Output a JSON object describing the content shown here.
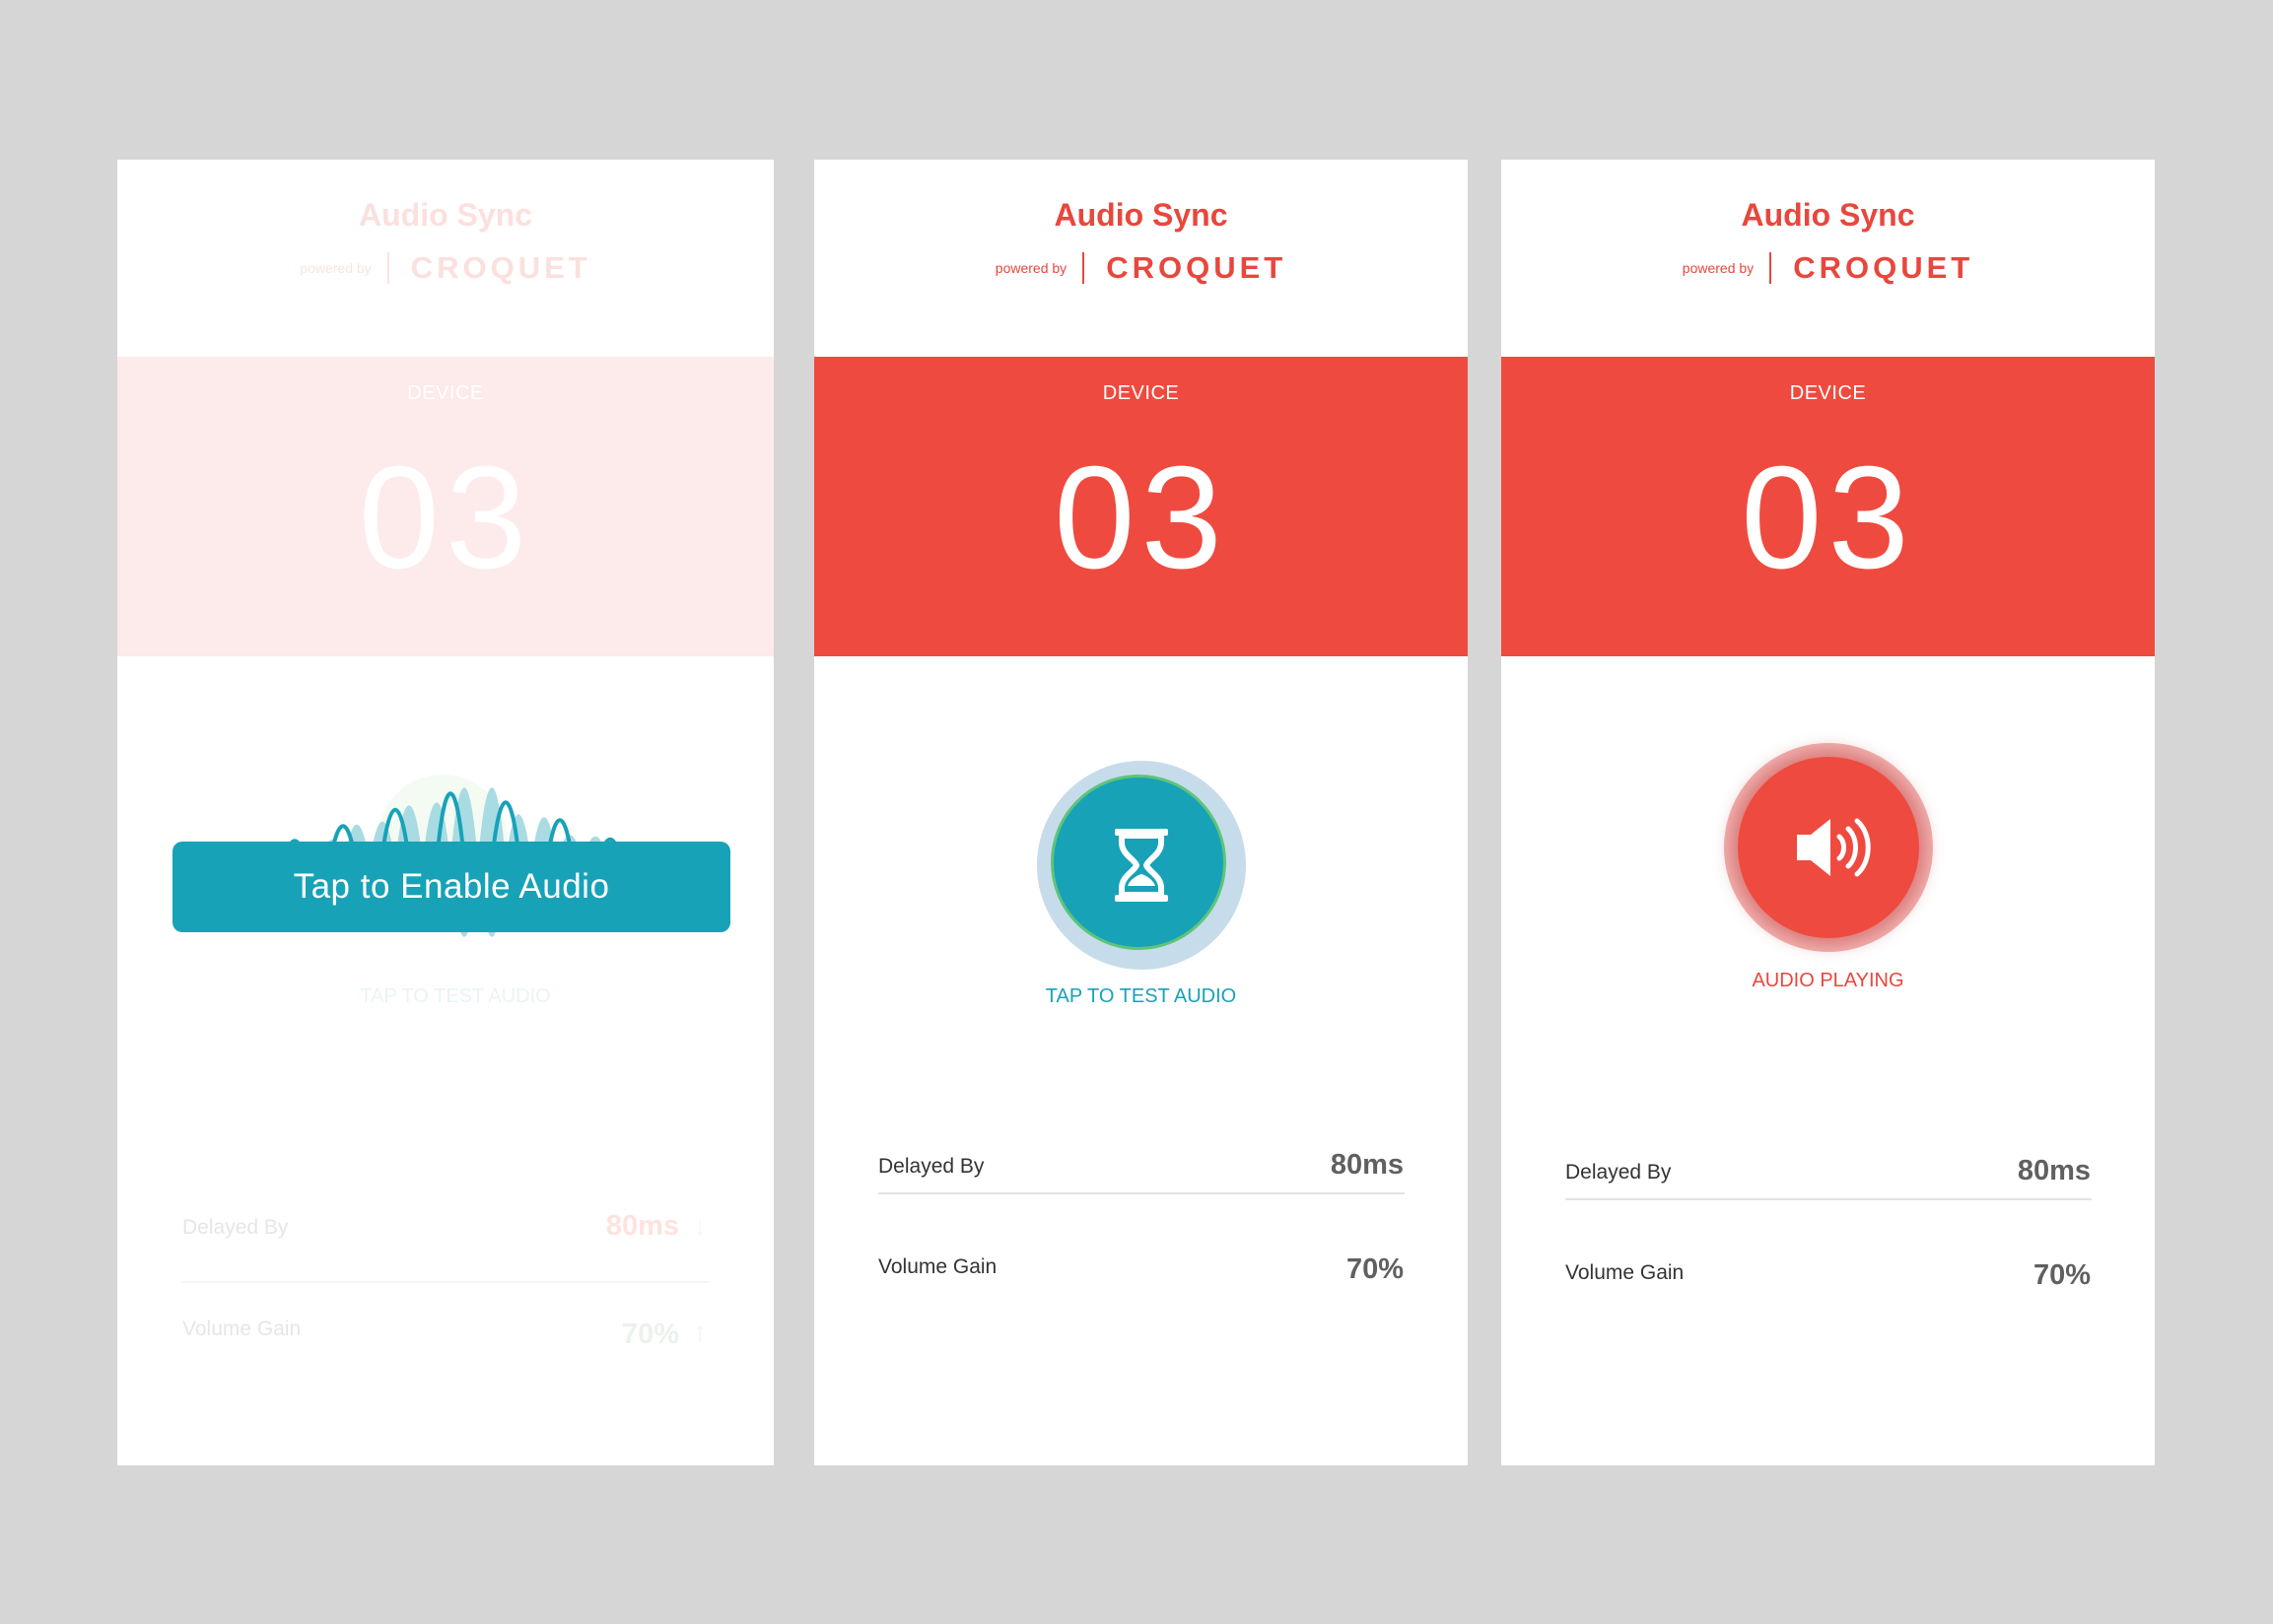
{
  "screens": [
    {
      "app_title": "Audio Sync",
      "powered_by": "powered by",
      "brand": "CROQUET",
      "device_label": "DEVICE",
      "device_number": "03",
      "enable_button": "Tap to Enable Audio",
      "status_text": "TAP TO TEST AUDIO",
      "rows": [
        {
          "label": "Delayed By",
          "value": "80ms",
          "arrow": "↓"
        },
        {
          "label": "Volume Gain",
          "value": "70%",
          "arrow": "↑"
        }
      ]
    },
    {
      "app_title": "Audio Sync",
      "powered_by": "powered by",
      "brand": "CROQUET",
      "device_label": "DEVICE",
      "device_number": "03",
      "status_text": "TAP TO TEST AUDIO",
      "status_icon": "hourglass-icon",
      "rows": [
        {
          "label": "Delayed By",
          "value": "80ms"
        },
        {
          "label": "Volume Gain",
          "value": "70%"
        }
      ]
    },
    {
      "app_title": "Audio Sync",
      "powered_by": "powered by",
      "brand": "CROQUET",
      "device_label": "DEVICE",
      "device_number": "03",
      "status_text": "AUDIO PLAYING",
      "status_icon": "speaker-icon",
      "rows": [
        {
          "label": "Delayed By",
          "value": "80ms"
        },
        {
          "label": "Volume Gain",
          "value": "70%"
        }
      ]
    }
  ],
  "colors": {
    "brand_red": "#ef4a3f",
    "teal": "#17a2b8",
    "background": "#d6d6d6"
  }
}
